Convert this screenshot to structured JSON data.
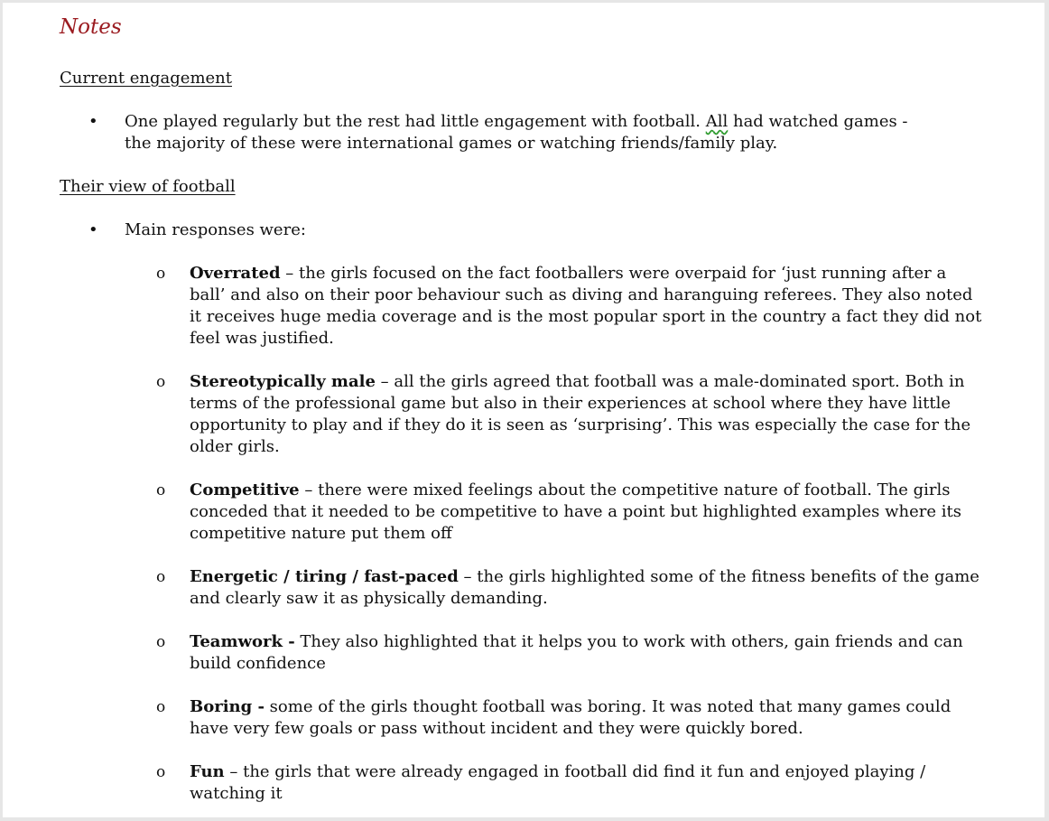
{
  "title": "Notes",
  "sections": [
    {
      "heading": "Current engagement",
      "bullet_icon": "•",
      "bullet": {
        "lead": "One played regularly but the rest had little engagement with football.  ",
        "flagged": "All",
        "tail": " had watched games - the majority of these were international games or watching friends/family play."
      }
    },
    {
      "heading": "Their view of football",
      "bullet_icon": "•",
      "bullet_text": "Main responses were:",
      "sub_icon": "o",
      "items": [
        {
          "term": "Overrated",
          "text": " – the girls focused on the fact footballers were overpaid for ‘just running after a ball’ and also on their poor behaviour such as diving and haranguing referees.  They also noted it receives huge media coverage and is the most popular sport in the country a fact they did not feel was justified."
        },
        {
          "term": "Stereotypically male",
          "text": " – all the girls agreed that football was a male-dominated sport.  Both in terms of the professional game but also in their experiences at school where they have little opportunity to play and if they do it is seen as ‘surprising’.  This was especially the case for the older girls."
        },
        {
          "term": "Competitive",
          "text": " – there were mixed feelings about the competitive nature of football.  The girls conceded that it needed to be competitive to have a point but highlighted examples where its competitive nature put them off"
        },
        {
          "term": "Energetic / tiring / fast-paced",
          "text": " – the girls highlighted some of the fitness benefits of the game and clearly saw it as physically demanding."
        },
        {
          "term": "Teamwork -",
          "text": " They also highlighted that it helps you to work with others, gain friends and can build confidence"
        },
        {
          "term": "Boring -",
          "text": " some of the girls thought football was boring.  It was noted that many games could have very few goals or pass without incident and they were quickly bored."
        },
        {
          "term": "Fun",
          "text": " – the girls that were already engaged in football did find it fun and enjoyed playing / watching it"
        }
      ]
    }
  ],
  "colors": {
    "title": "#9b1b20",
    "spellcheck": "#2e9b2e"
  }
}
